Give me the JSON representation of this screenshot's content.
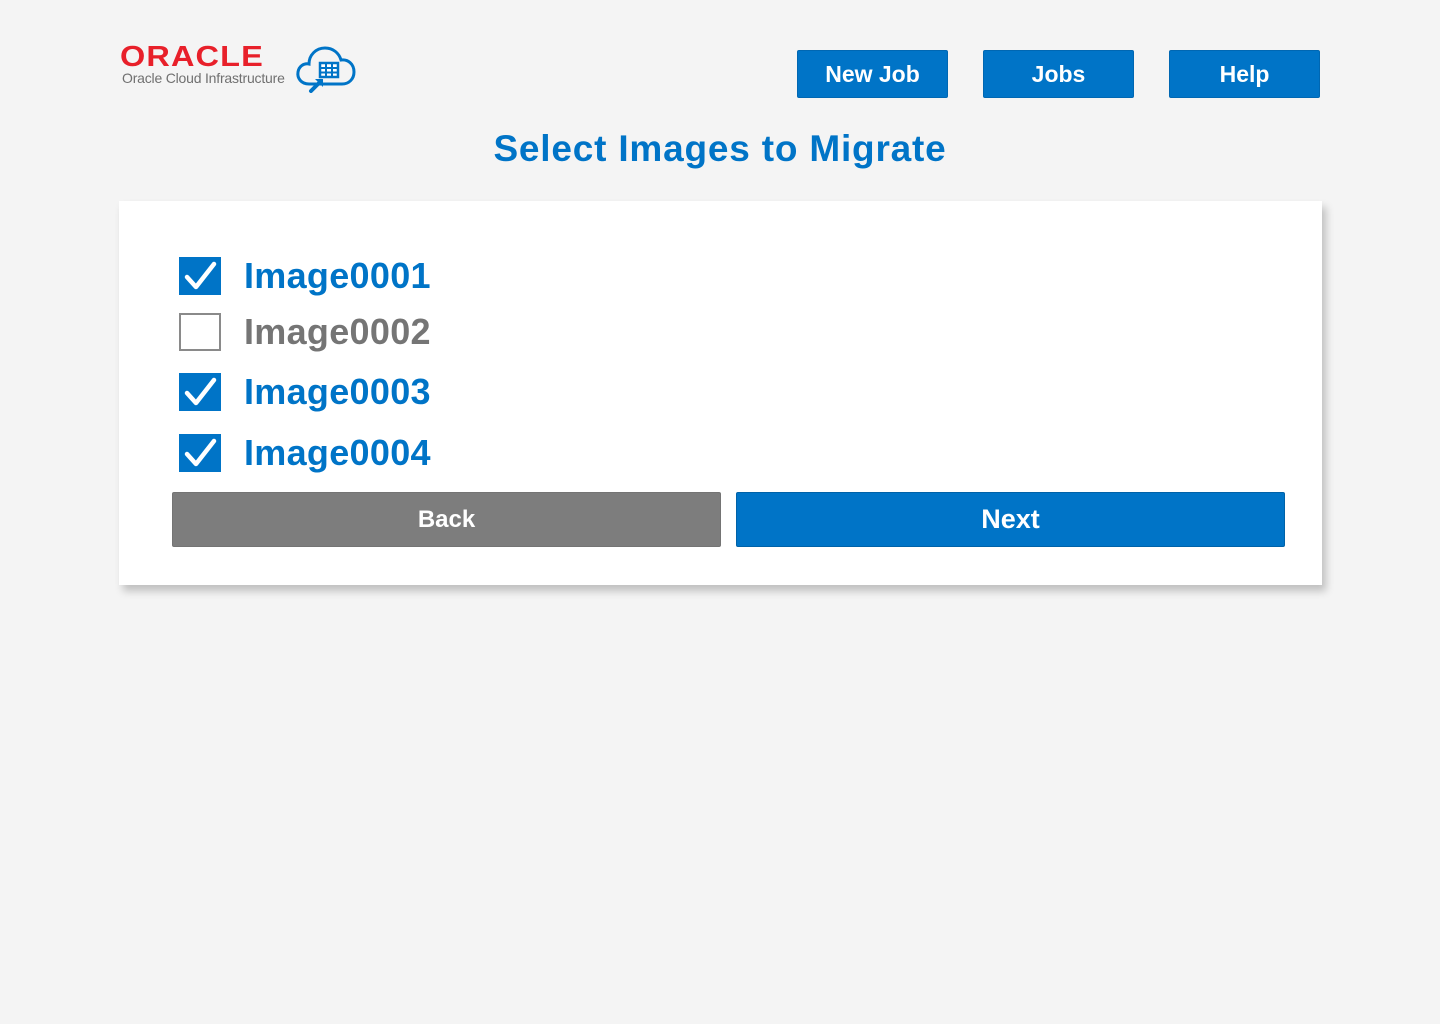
{
  "brand": {
    "wordmark": "ORACLE",
    "subtitle": "Oracle Cloud Infrastructure",
    "logo_color": "#e8202a",
    "cloud_icon": "cloud-migrate-icon"
  },
  "nav": {
    "new_job": "New Job",
    "jobs": "Jobs",
    "help": "Help"
  },
  "page": {
    "title": "Select Images to Migrate"
  },
  "images": [
    {
      "label": "Image0001",
      "checked": true
    },
    {
      "label": "Image0002",
      "checked": false
    },
    {
      "label": "Image0003",
      "checked": true
    },
    {
      "label": "Image0004",
      "checked": true
    }
  ],
  "actions": {
    "back": "Back",
    "next": "Next"
  },
  "colors": {
    "accent": "#0074c7",
    "secondary_button": "#7d7d7d",
    "background": "#f4f4f4"
  }
}
